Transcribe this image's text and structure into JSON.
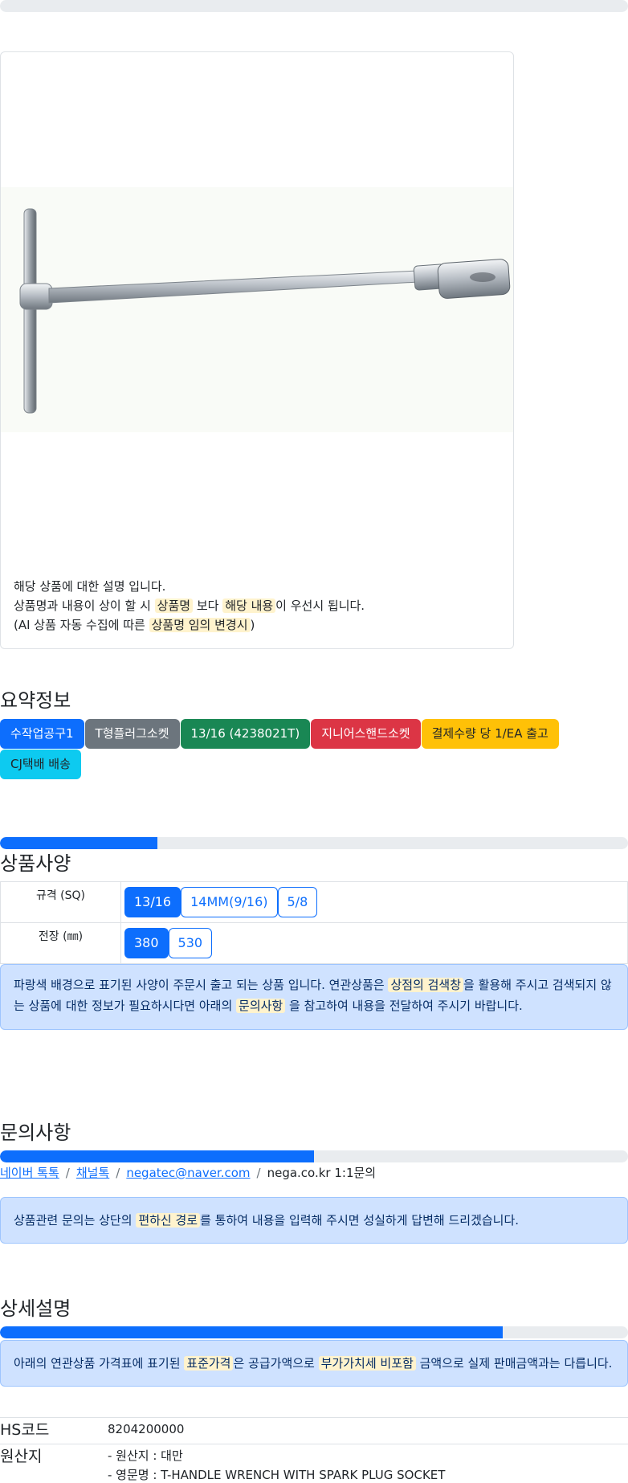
{
  "product_card": {
    "desc_line1": "해당 상품에 대한 설명 입니다.",
    "desc_line2_a": "상품명과 내용이 상이 할 시 ",
    "desc_line2_hl1": "상품명",
    "desc_line2_b": " 보다 ",
    "desc_line2_hl2": "해당 내용",
    "desc_line2_c": "이 우선시 됩니다.",
    "desc_line3_a": "(AI 상품 자동 수집에 따른 ",
    "desc_line3_hl": "상품명 임의 변경시",
    "desc_line3_b": ")"
  },
  "summary": {
    "title": "요약정보",
    "tags": [
      "수작업공구1",
      "T형플러그소켓",
      "13/16 (4238021T)",
      "지니어스핸드소켓",
      "결제수량 당 1/EA 출고",
      "CJ택배 배송"
    ]
  },
  "spec": {
    "title": "상품사양",
    "progress": 0.25,
    "rows": [
      {
        "label": "규격 (SQ)",
        "options": [
          "13/16",
          "14MM(9/16)",
          "5/8"
        ],
        "selected": 0
      },
      {
        "label": "전장 (㎜)",
        "options": [
          "380",
          "530"
        ],
        "selected": 0
      }
    ],
    "note_a": "파랑색 배경으로 표기된 사양이 주문시 출고 되는 상품 입니다. 연관상품은 ",
    "note_hl1": "상점의 검색창",
    "note_b": "을 활용해 주시고 검색되지 않는 상품에 대한 정보가 필요하시다면 아래의 ",
    "note_hl2": "문의사항",
    "note_c": " 을 참고하여 내용을 전달하여 주시기 바랍니다."
  },
  "inquiry": {
    "title": "문의사항",
    "progress": 0.5,
    "links": [
      "네이버 톡톡",
      "채널톡",
      "negatec@naver.com"
    ],
    "plain": "nega.co.kr 1:1문의",
    "note_a": "상품관련 문의는 상단의 ",
    "note_hl": "편하신 경로",
    "note_b": "를 통하여 내용을 입력해 주시면 성실하게 답변해 드리겠습니다."
  },
  "detail": {
    "title": "상세설명",
    "progress": 0.8,
    "note_a": "아래의 연관상품 가격표에 표기된 ",
    "note_hl1": "표준가격",
    "note_b": "은 공급가액으로 ",
    "note_hl2": "부가가치세 비포함",
    "note_c": " 금액으로 실제 판매금액과는 다릅니다.",
    "hs_label": "HS코드",
    "hs_value": "8204200000",
    "origin_label": "원산지",
    "origin_line1": "- 원산지 : 대만",
    "origin_line2": "- 영문명 : T-HANDLE WRENCH WITH SPARK PLUG SOCKET"
  },
  "colors": {
    "primary": "#0d6efd",
    "highlight": "#fff3cd",
    "alert_bg": "#cfe2ff"
  }
}
